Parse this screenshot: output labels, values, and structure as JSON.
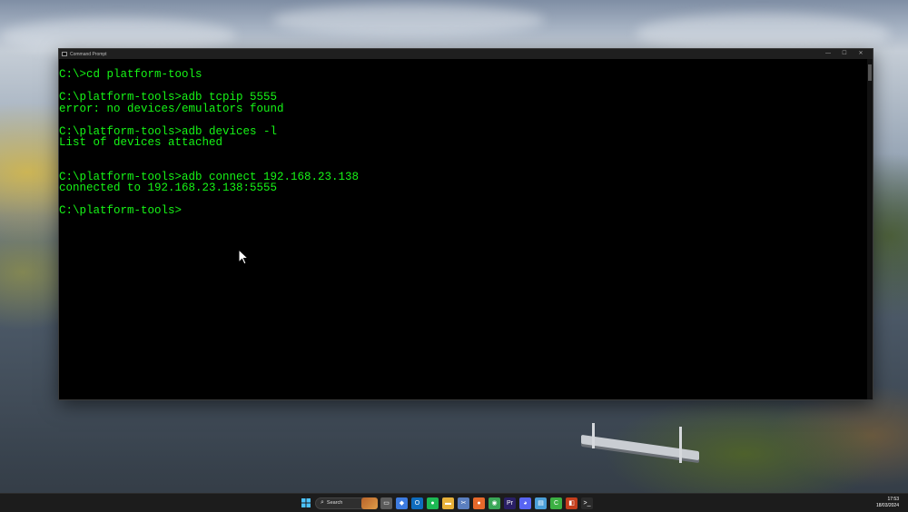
{
  "window": {
    "title": "Command Prompt",
    "controls": {
      "minimize": "—",
      "maximize": "☐",
      "close": "✕"
    }
  },
  "console": {
    "text_color": "#16f516",
    "lines": [
      "C:\\>cd platform-tools",
      "",
      "C:\\platform-tools>adb tcpip 5555",
      "error: no devices/emulators found",
      "",
      "C:\\platform-tools>adb devices -l",
      "List of devices attached",
      "",
      "",
      "C:\\platform-tools>adb connect 192.168.23.138",
      "connected to 192.168.23.138:5555",
      "",
      "C:\\platform-tools>"
    ]
  },
  "taskbar": {
    "search_label": "Search",
    "apps": [
      {
        "name": "task-view",
        "glyph": "▭",
        "color": "#5a5a5a"
      },
      {
        "name": "copilot",
        "glyph": "◆",
        "color": "#3d7be0"
      },
      {
        "name": "outlook",
        "glyph": "O",
        "color": "#0f6cbd"
      },
      {
        "name": "spotify",
        "glyph": "●",
        "color": "#1db954"
      },
      {
        "name": "file-explorer",
        "glyph": "▬",
        "color": "#e8b13a"
      },
      {
        "name": "snipping-tool",
        "glyph": "✂",
        "color": "#5b7fbf"
      },
      {
        "name": "firefox",
        "glyph": "●",
        "color": "#e8692b"
      },
      {
        "name": "chrome",
        "glyph": "◉",
        "color": "#3aa757"
      },
      {
        "name": "premiere-pro",
        "glyph": "Pr",
        "color": "#2a1f66"
      },
      {
        "name": "discord",
        "glyph": "◕",
        "color": "#5865f2"
      },
      {
        "name": "notepad",
        "glyph": "▤",
        "color": "#4b9fd8"
      },
      {
        "name": "clipchamp",
        "glyph": "C",
        "color": "#3cb043"
      },
      {
        "name": "powerpoint",
        "glyph": "◧",
        "color": "#c43e1c"
      },
      {
        "name": "terminal",
        "glyph": ">_",
        "color": "#2b2b2b"
      }
    ],
    "clock": {
      "time": "17:53",
      "date": "18/03/2024"
    }
  }
}
